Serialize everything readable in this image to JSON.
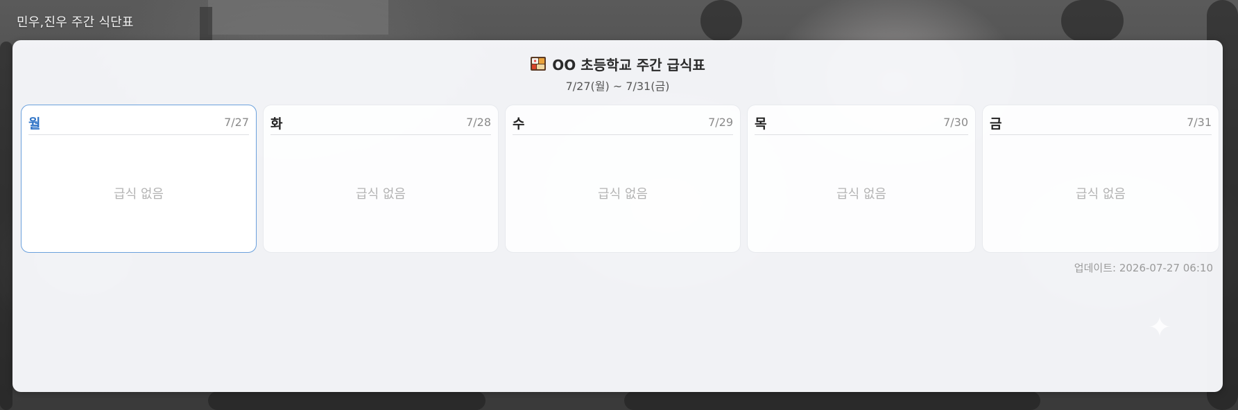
{
  "window": {
    "title": "민우,진우 주간 식단표"
  },
  "header": {
    "icon": "bento-box-icon",
    "title": "OO 초등학교 주간 급식표",
    "subtitle": "7/27(월) ~ 7/31(금)"
  },
  "days": [
    {
      "name": "월",
      "date": "7/27",
      "status": "급식 없음",
      "selected": true
    },
    {
      "name": "화",
      "date": "7/28",
      "status": "급식 없음",
      "selected": false
    },
    {
      "name": "수",
      "date": "7/29",
      "status": "급식 없음",
      "selected": false
    },
    {
      "name": "목",
      "date": "7/30",
      "status": "급식 없음",
      "selected": false
    },
    {
      "name": "금",
      "date": "7/31",
      "status": "급식 없음",
      "selected": false
    }
  ],
  "footer": {
    "updated": "업데이트: 2026-07-27 06:10"
  },
  "colors": {
    "accent": "#2f74c7",
    "active_border": "#6aa0dc",
    "muted_text": "#b3b3b3"
  }
}
